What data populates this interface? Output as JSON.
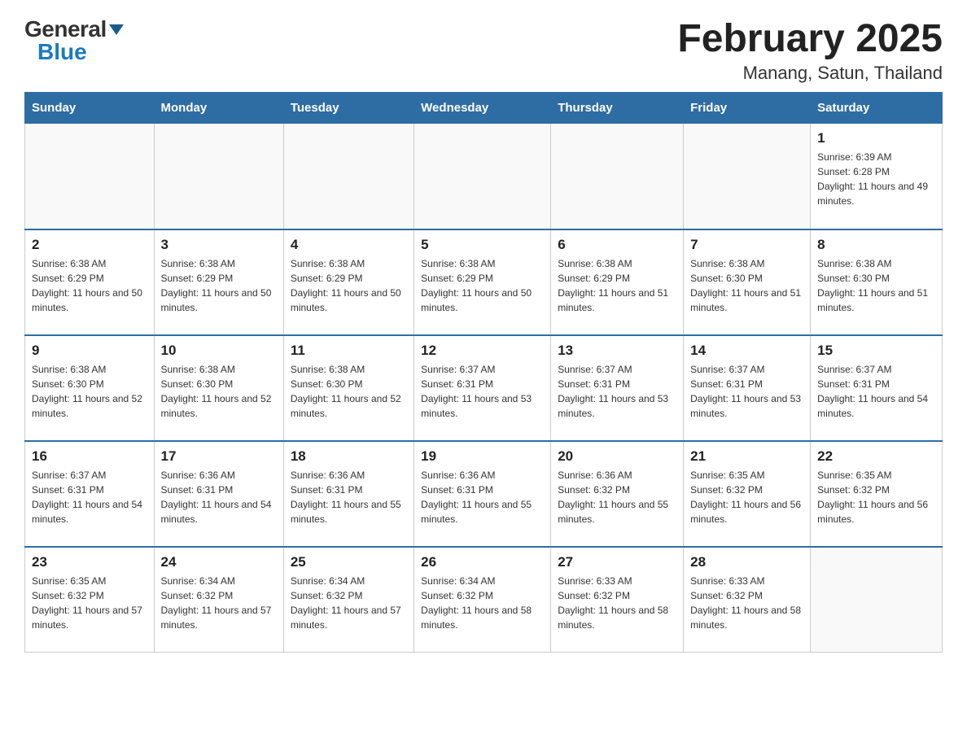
{
  "header": {
    "logo_general": "General",
    "logo_blue": "Blue",
    "month_title": "February 2025",
    "location": "Manang, Satun, Thailand"
  },
  "weekdays": [
    "Sunday",
    "Monday",
    "Tuesday",
    "Wednesday",
    "Thursday",
    "Friday",
    "Saturday"
  ],
  "weeks": [
    [
      {
        "day": "",
        "sunrise": "",
        "sunset": "",
        "daylight": ""
      },
      {
        "day": "",
        "sunrise": "",
        "sunset": "",
        "daylight": ""
      },
      {
        "day": "",
        "sunrise": "",
        "sunset": "",
        "daylight": ""
      },
      {
        "day": "",
        "sunrise": "",
        "sunset": "",
        "daylight": ""
      },
      {
        "day": "",
        "sunrise": "",
        "sunset": "",
        "daylight": ""
      },
      {
        "day": "",
        "sunrise": "",
        "sunset": "",
        "daylight": ""
      },
      {
        "day": "1",
        "sunrise": "Sunrise: 6:39 AM",
        "sunset": "Sunset: 6:28 PM",
        "daylight": "Daylight: 11 hours and 49 minutes."
      }
    ],
    [
      {
        "day": "2",
        "sunrise": "Sunrise: 6:38 AM",
        "sunset": "Sunset: 6:29 PM",
        "daylight": "Daylight: 11 hours and 50 minutes."
      },
      {
        "day": "3",
        "sunrise": "Sunrise: 6:38 AM",
        "sunset": "Sunset: 6:29 PM",
        "daylight": "Daylight: 11 hours and 50 minutes."
      },
      {
        "day": "4",
        "sunrise": "Sunrise: 6:38 AM",
        "sunset": "Sunset: 6:29 PM",
        "daylight": "Daylight: 11 hours and 50 minutes."
      },
      {
        "day": "5",
        "sunrise": "Sunrise: 6:38 AM",
        "sunset": "Sunset: 6:29 PM",
        "daylight": "Daylight: 11 hours and 50 minutes."
      },
      {
        "day": "6",
        "sunrise": "Sunrise: 6:38 AM",
        "sunset": "Sunset: 6:29 PM",
        "daylight": "Daylight: 11 hours and 51 minutes."
      },
      {
        "day": "7",
        "sunrise": "Sunrise: 6:38 AM",
        "sunset": "Sunset: 6:30 PM",
        "daylight": "Daylight: 11 hours and 51 minutes."
      },
      {
        "day": "8",
        "sunrise": "Sunrise: 6:38 AM",
        "sunset": "Sunset: 6:30 PM",
        "daylight": "Daylight: 11 hours and 51 minutes."
      }
    ],
    [
      {
        "day": "9",
        "sunrise": "Sunrise: 6:38 AM",
        "sunset": "Sunset: 6:30 PM",
        "daylight": "Daylight: 11 hours and 52 minutes."
      },
      {
        "day": "10",
        "sunrise": "Sunrise: 6:38 AM",
        "sunset": "Sunset: 6:30 PM",
        "daylight": "Daylight: 11 hours and 52 minutes."
      },
      {
        "day": "11",
        "sunrise": "Sunrise: 6:38 AM",
        "sunset": "Sunset: 6:30 PM",
        "daylight": "Daylight: 11 hours and 52 minutes."
      },
      {
        "day": "12",
        "sunrise": "Sunrise: 6:37 AM",
        "sunset": "Sunset: 6:31 PM",
        "daylight": "Daylight: 11 hours and 53 minutes."
      },
      {
        "day": "13",
        "sunrise": "Sunrise: 6:37 AM",
        "sunset": "Sunset: 6:31 PM",
        "daylight": "Daylight: 11 hours and 53 minutes."
      },
      {
        "day": "14",
        "sunrise": "Sunrise: 6:37 AM",
        "sunset": "Sunset: 6:31 PM",
        "daylight": "Daylight: 11 hours and 53 minutes."
      },
      {
        "day": "15",
        "sunrise": "Sunrise: 6:37 AM",
        "sunset": "Sunset: 6:31 PM",
        "daylight": "Daylight: 11 hours and 54 minutes."
      }
    ],
    [
      {
        "day": "16",
        "sunrise": "Sunrise: 6:37 AM",
        "sunset": "Sunset: 6:31 PM",
        "daylight": "Daylight: 11 hours and 54 minutes."
      },
      {
        "day": "17",
        "sunrise": "Sunrise: 6:36 AM",
        "sunset": "Sunset: 6:31 PM",
        "daylight": "Daylight: 11 hours and 54 minutes."
      },
      {
        "day": "18",
        "sunrise": "Sunrise: 6:36 AM",
        "sunset": "Sunset: 6:31 PM",
        "daylight": "Daylight: 11 hours and 55 minutes."
      },
      {
        "day": "19",
        "sunrise": "Sunrise: 6:36 AM",
        "sunset": "Sunset: 6:31 PM",
        "daylight": "Daylight: 11 hours and 55 minutes."
      },
      {
        "day": "20",
        "sunrise": "Sunrise: 6:36 AM",
        "sunset": "Sunset: 6:32 PM",
        "daylight": "Daylight: 11 hours and 55 minutes."
      },
      {
        "day": "21",
        "sunrise": "Sunrise: 6:35 AM",
        "sunset": "Sunset: 6:32 PM",
        "daylight": "Daylight: 11 hours and 56 minutes."
      },
      {
        "day": "22",
        "sunrise": "Sunrise: 6:35 AM",
        "sunset": "Sunset: 6:32 PM",
        "daylight": "Daylight: 11 hours and 56 minutes."
      }
    ],
    [
      {
        "day": "23",
        "sunrise": "Sunrise: 6:35 AM",
        "sunset": "Sunset: 6:32 PM",
        "daylight": "Daylight: 11 hours and 57 minutes."
      },
      {
        "day": "24",
        "sunrise": "Sunrise: 6:34 AM",
        "sunset": "Sunset: 6:32 PM",
        "daylight": "Daylight: 11 hours and 57 minutes."
      },
      {
        "day": "25",
        "sunrise": "Sunrise: 6:34 AM",
        "sunset": "Sunset: 6:32 PM",
        "daylight": "Daylight: 11 hours and 57 minutes."
      },
      {
        "day": "26",
        "sunrise": "Sunrise: 6:34 AM",
        "sunset": "Sunset: 6:32 PM",
        "daylight": "Daylight: 11 hours and 58 minutes."
      },
      {
        "day": "27",
        "sunrise": "Sunrise: 6:33 AM",
        "sunset": "Sunset: 6:32 PM",
        "daylight": "Daylight: 11 hours and 58 minutes."
      },
      {
        "day": "28",
        "sunrise": "Sunrise: 6:33 AM",
        "sunset": "Sunset: 6:32 PM",
        "daylight": "Daylight: 11 hours and 58 minutes."
      },
      {
        "day": "",
        "sunrise": "",
        "sunset": "",
        "daylight": ""
      }
    ]
  ]
}
